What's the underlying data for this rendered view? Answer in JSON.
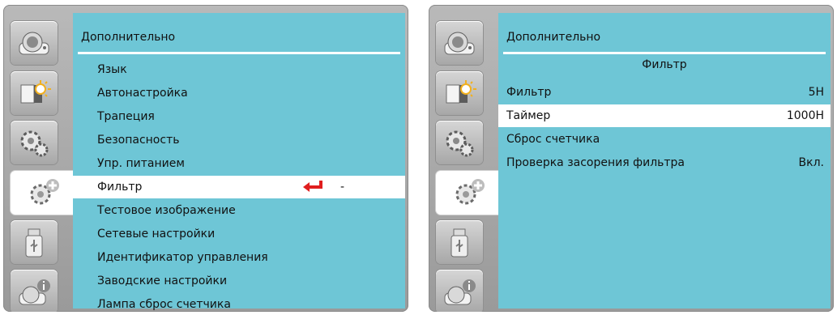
{
  "left_screen": {
    "title": "Дополнительно",
    "items": [
      {
        "label": "Язык"
      },
      {
        "label": "Автонастройка"
      },
      {
        "label": "Трапеция"
      },
      {
        "label": "Безопасность"
      },
      {
        "label": "Упр. питанием"
      },
      {
        "label": "Фильтр",
        "value": "-"
      },
      {
        "label": "Тестовое изображение"
      },
      {
        "label": "Сетевые настройки"
      },
      {
        "label": "Идентификатор управления"
      },
      {
        "label": "Заводские настройки"
      },
      {
        "label": "Лампа сброс счетчика"
      }
    ],
    "selected_index": 5
  },
  "right_screen": {
    "title": "Дополнительно",
    "subtitle": "Фильтр",
    "items": [
      {
        "label": "Фильтр",
        "value": "5H"
      },
      {
        "label": "Таймер",
        "value": "1000H"
      },
      {
        "label": "Сброс счетчика",
        "value": ""
      },
      {
        "label": "Проверка засорения фильтра",
        "value": "Вкл."
      }
    ],
    "selected_index": 1
  },
  "sidebar_icons": [
    "projector-icon",
    "picture-brightness-icon",
    "settings-gears-icon",
    "advanced-settings-icon",
    "usb-icon",
    "information-icon"
  ],
  "colors": {
    "panel": "#6ec6d6",
    "selection": "#ffffff",
    "enter_arrow": "#e01e1e",
    "frame": "#a8a8a8"
  }
}
